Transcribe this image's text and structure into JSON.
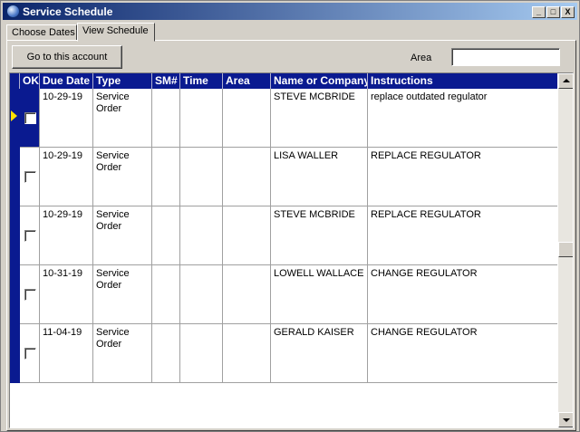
{
  "window": {
    "title": "Service Schedule",
    "minimize_label": "_",
    "maximize_label": "□",
    "close_label": "X"
  },
  "tabs": [
    {
      "label": "Choose Dates",
      "active": false
    },
    {
      "label": "View Schedule",
      "active": true
    }
  ],
  "toolbar": {
    "go_button_label": "Go to this account",
    "area_label": "Area",
    "area_value": ""
  },
  "grid": {
    "columns": [
      "OK",
      "Due Date",
      "Type",
      "SM#",
      "Time",
      "Area",
      "Name or Company",
      "Instructions"
    ],
    "rows": [
      {
        "due_date": "10-29-19",
        "type_line1": "Service",
        "type_line2": "Order",
        "sm": "",
        "time": "",
        "area": "",
        "name": "STEVE MCBRIDE",
        "instructions": "replace outdated regulator",
        "ok": false,
        "current": true
      },
      {
        "due_date": "10-29-19",
        "type_line1": "Service",
        "type_line2": "Order",
        "sm": "",
        "time": "",
        "area": "",
        "name": "LISA WALLER",
        "instructions": "REPLACE REGULATOR",
        "ok": false,
        "current": false
      },
      {
        "due_date": "10-29-19",
        "type_line1": "Service",
        "type_line2": "Order",
        "sm": "",
        "time": "",
        "area": "",
        "name": "STEVE MCBRIDE",
        "instructions": "REPLACE REGULATOR",
        "ok": false,
        "current": false
      },
      {
        "due_date": "10-31-19",
        "type_line1": "Service",
        "type_line2": "Order",
        "sm": "",
        "time": "",
        "area": "",
        "name": "LOWELL WALLACE",
        "instructions": "CHANGE REGULATOR",
        "ok": false,
        "current": false
      },
      {
        "due_date": "11-04-19",
        "type_line1": "Service",
        "type_line2": "Order",
        "sm": "",
        "time": "",
        "area": "",
        "name": "GERALD KAISER",
        "instructions": "CHANGE REGULATOR",
        "ok": false,
        "current": false
      }
    ]
  },
  "colors": {
    "titlebar_start": "#0a246a",
    "titlebar_end": "#a6caf0",
    "grid_header": "#0a1a90",
    "current_row_arrow": "#ffe000",
    "face": "#d4d0c8"
  }
}
